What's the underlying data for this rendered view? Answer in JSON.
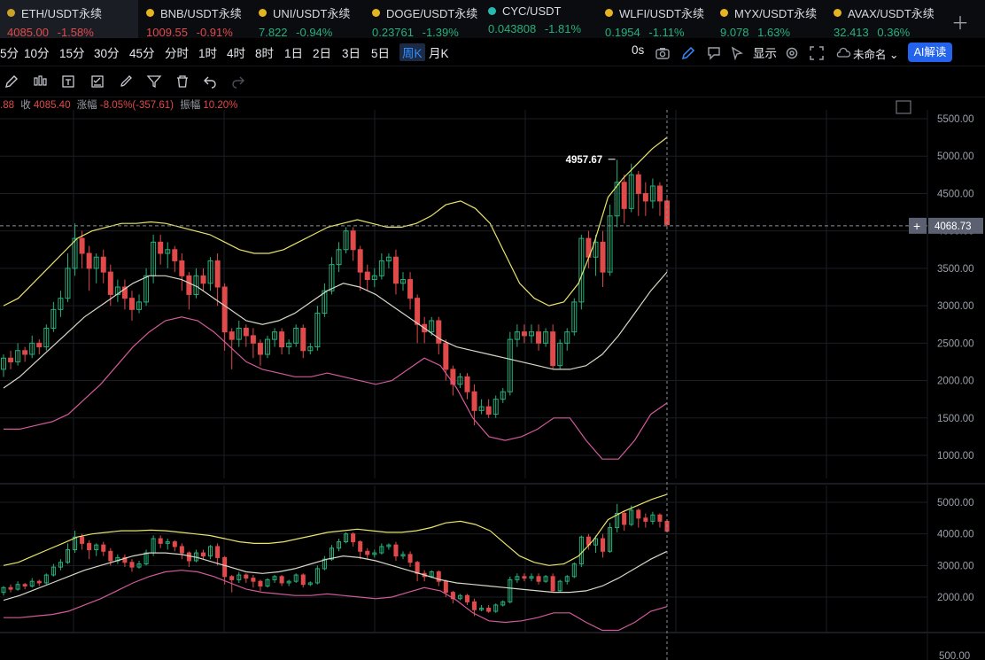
{
  "tabs": [
    {
      "name": "ETH/USDT永续",
      "price": "4085.00",
      "change": "-1.58%",
      "dir": "dn",
      "active": true,
      "dotColor": "#c9a227"
    },
    {
      "name": "BNB/USDT永续",
      "price": "1009.55",
      "change": "-0.91%",
      "dir": "dn",
      "dotColor": "#e6b422"
    },
    {
      "name": "UNI/USDT永续",
      "price": "7.822",
      "change": "-0.94%",
      "dir": "up",
      "dotColor": "#e6b422"
    },
    {
      "name": "DOGE/USDT永续",
      "price": "0.23761",
      "change": "-1.39%",
      "dir": "up",
      "dotColor": "#e6b422"
    },
    {
      "name": "CYC/USDT",
      "price": "0.043808",
      "change": "-1.81%",
      "dir": "up",
      "dotColor": "#27b8b0"
    },
    {
      "name": "WLFI/USDT永续",
      "price": "0.1954",
      "change": "-1.11%",
      "dir": "up",
      "dotColor": "#e6b422"
    },
    {
      "name": "MYX/USDT永续",
      "price": "9.078",
      "change": "1.63%",
      "dir": "up",
      "dotColor": "#e6b422"
    },
    {
      "name": "AVAX/USDT永续",
      "price": "32.413",
      "change": "0.36%",
      "dir": "up",
      "dotColor": "#e6b422"
    }
  ],
  "timeframes": [
    "5分",
    "10分",
    "15分",
    "30分",
    "45分",
    "分时",
    "1时",
    "4时",
    "8时",
    "1日",
    "2日",
    "3日",
    "5日",
    "周K",
    "月K"
  ],
  "activeTimeframe": "周K",
  "toolbarRight": {
    "countdown": "0s",
    "display": "显示",
    "layout": "未命名",
    "ai": "AI解读"
  },
  "icons": [
    "pencil-icon",
    "candles-icon",
    "text-tool-icon",
    "checklist-icon",
    "brush-icon",
    "filter-icon",
    "trash-icon",
    "undo-icon",
    "redo-icon",
    "camera-icon",
    "edit-icon",
    "alert-icon",
    "settings-icon",
    "fullscreen-icon",
    "cloud-icon"
  ],
  "info": {
    "prefix": ".88",
    "close_label": "收",
    "close": "4085.40",
    "chg_label": "涨幅",
    "chg": "-8.05%(-357.61)",
    "amp_label": "振幅",
    "amp": "10.20%"
  },
  "colors": {
    "up": "#26b07a",
    "down": "#e04a4a",
    "upper_band": "#e9e46a",
    "middle_band": "#d8d8c8",
    "lower_band": "#d25a9a",
    "crosshair_label_bg": "#5b6170"
  },
  "chart_data": {
    "type": "candlestick",
    "main": {
      "yticks": [
        5500,
        5000,
        4500,
        4000,
        3500,
        3000,
        2500,
        2000,
        1500,
        1000
      ],
      "ylim": [
        750,
        5650
      ],
      "high_label": "4957.67",
      "crosshair_value": "4068.73",
      "candles": [
        [
          2150,
          2300,
          2050,
          2350
        ],
        [
          2300,
          2250,
          2150,
          2400
        ],
        [
          2250,
          2400,
          2200,
          2500
        ],
        [
          2400,
          2350,
          2250,
          2450
        ],
        [
          2350,
          2500,
          2300,
          2600
        ],
        [
          2500,
          2450,
          2350,
          2550
        ],
        [
          2450,
          2700,
          2400,
          2750
        ],
        [
          2700,
          2950,
          2650,
          3050
        ],
        [
          2950,
          3100,
          2850,
          3200
        ],
        [
          3100,
          3500,
          3050,
          3700
        ],
        [
          3500,
          3900,
          3400,
          4100
        ],
        [
          3900,
          3700,
          3500,
          4000
        ],
        [
          3700,
          3500,
          3200,
          3800
        ],
        [
          3500,
          3650,
          3300,
          3700
        ],
        [
          3650,
          3450,
          3300,
          3750
        ],
        [
          3450,
          3150,
          3000,
          3550
        ],
        [
          3150,
          3250,
          3050,
          3350
        ],
        [
          3250,
          3100,
          2950,
          3350
        ],
        [
          3100,
          2950,
          2800,
          3200
        ],
        [
          2950,
          3050,
          2900,
          3150
        ],
        [
          3050,
          3400,
          3000,
          3500
        ],
        [
          3400,
          3850,
          3300,
          3950
        ],
        [
          3850,
          3700,
          3550,
          3950
        ],
        [
          3700,
          3750,
          3500,
          3850
        ],
        [
          3750,
          3600,
          3450,
          3800
        ],
        [
          3600,
          3400,
          3200,
          3700
        ],
        [
          3400,
          3150,
          2950,
          3450
        ],
        [
          3150,
          3400,
          3100,
          3500
        ],
        [
          3400,
          3300,
          3200,
          3500
        ],
        [
          3300,
          3600,
          3200,
          3650
        ],
        [
          3600,
          3250,
          3000,
          3700
        ],
        [
          3250,
          2650,
          2400,
          3300
        ],
        [
          2650,
          2550,
          2150,
          2700
        ],
        [
          2550,
          2700,
          2450,
          2800
        ],
        [
          2700,
          2600,
          2450,
          2750
        ],
        [
          2600,
          2500,
          2300,
          2700
        ],
        [
          2500,
          2350,
          2200,
          2550
        ],
        [
          2350,
          2550,
          2300,
          2600
        ],
        [
          2550,
          2650,
          2450,
          2700
        ],
        [
          2650,
          2450,
          2350,
          2700
        ],
        [
          2450,
          2500,
          2350,
          2550
        ],
        [
          2500,
          2700,
          2450,
          2750
        ],
        [
          2700,
          2400,
          2300,
          2750
        ],
        [
          2400,
          2450,
          2350,
          2500
        ],
        [
          2450,
          2900,
          2400,
          3000
        ],
        [
          2900,
          3200,
          2850,
          3300
        ],
        [
          3200,
          3550,
          3150,
          3650
        ],
        [
          3550,
          3750,
          3450,
          3850
        ],
        [
          3750,
          4000,
          3700,
          4050
        ],
        [
          4000,
          3750,
          3600,
          4050
        ],
        [
          3750,
          3450,
          3200,
          3800
        ],
        [
          3450,
          3350,
          3200,
          3550
        ],
        [
          3350,
          3400,
          3250,
          3500
        ],
        [
          3400,
          3600,
          3350,
          3700
        ],
        [
          3600,
          3650,
          3500,
          3700
        ],
        [
          3650,
          3300,
          3150,
          3750
        ],
        [
          3300,
          3350,
          3200,
          3450
        ],
        [
          3350,
          3100,
          2950,
          3450
        ],
        [
          3100,
          2750,
          2500,
          3150
        ],
        [
          2750,
          2650,
          2500,
          2850
        ],
        [
          2650,
          2800,
          2600,
          2850
        ],
        [
          2800,
          2500,
          2350,
          2850
        ],
        [
          2500,
          2150,
          2000,
          2550
        ],
        [
          2150,
          1950,
          1800,
          2200
        ],
        [
          1950,
          2050,
          1900,
          2100
        ],
        [
          2050,
          1850,
          1750,
          2100
        ],
        [
          1850,
          1600,
          1400,
          1950
        ],
        [
          1600,
          1650,
          1550,
          1750
        ],
        [
          1650,
          1550,
          1500,
          1750
        ],
        [
          1550,
          1750,
          1500,
          1800
        ],
        [
          1750,
          1850,
          1700,
          1900
        ],
        [
          1850,
          2550,
          1800,
          2650
        ],
        [
          2550,
          2650,
          2450,
          2750
        ],
        [
          2650,
          2600,
          2500,
          2750
        ],
        [
          2600,
          2650,
          2500,
          2750
        ],
        [
          2650,
          2500,
          2400,
          2750
        ],
        [
          2500,
          2650,
          2450,
          2700
        ],
        [
          2650,
          2200,
          2150,
          2750
        ],
        [
          2200,
          2500,
          2150,
          2550
        ],
        [
          2500,
          2650,
          2400,
          2700
        ],
        [
          2650,
          3050,
          2600,
          3100
        ],
        [
          3050,
          3900,
          2950,
          3950
        ],
        [
          3900,
          3650,
          3500,
          4000
        ],
        [
          3650,
          3850,
          3400,
          3950
        ],
        [
          3850,
          3450,
          3250,
          4000
        ],
        [
          3450,
          4200,
          3400,
          4350
        ],
        [
          4200,
          4650,
          4050,
          4950
        ],
        [
          4650,
          4300,
          4100,
          4750
        ],
        [
          4300,
          4750,
          4250,
          4900
        ],
        [
          4750,
          4500,
          4200,
          4800
        ],
        [
          4500,
          4400,
          4200,
          4650
        ],
        [
          4400,
          4600,
          4300,
          4700
        ],
        [
          4600,
          4400,
          4200,
          4650
        ],
        [
          4400,
          4085,
          4050,
          4450
        ]
      ],
      "bands": {
        "upper": [
          3000,
          3100,
          3300,
          3500,
          3700,
          3900,
          4000,
          4050,
          4100,
          4100,
          4120,
          4100,
          4050,
          4000,
          3950,
          3850,
          3750,
          3700,
          3700,
          3750,
          3850,
          3950,
          4050,
          4100,
          4150,
          4100,
          4050,
          4050,
          4100,
          4200,
          4350,
          4400,
          4300,
          4100,
          3700,
          3300,
          3100,
          3000,
          3050,
          3300,
          3800,
          4450,
          4700,
          4900,
          5100,
          5250
        ],
        "middle": [
          1900,
          2050,
          2250,
          2450,
          2650,
          2850,
          3000,
          3150,
          3300,
          3400,
          3400,
          3350,
          3250,
          3100,
          2950,
          2800,
          2750,
          2800,
          2900,
          3050,
          3200,
          3300,
          3250,
          3150,
          3000,
          2850,
          2700,
          2550,
          2450,
          2400,
          2350,
          2300,
          2250,
          2200,
          2150,
          2150,
          2200,
          2350,
          2600,
          2900,
          3200,
          3450
        ],
        "lower": [
          1350,
          1350,
          1400,
          1450,
          1550,
          1750,
          1950,
          2200,
          2450,
          2650,
          2800,
          2850,
          2800,
          2650,
          2450,
          2250,
          2150,
          2100,
          2050,
          2050,
          2100,
          2050,
          2000,
          1950,
          2000,
          2150,
          2300,
          2200,
          1900,
          1500,
          1250,
          1200,
          1250,
          1350,
          1500,
          1500,
          1200,
          950,
          950,
          1200,
          1550,
          1700
        ]
      }
    },
    "sub": {
      "yticks": [
        5000,
        4000,
        3000,
        2000
      ],
      "ylim": [
        1100,
        5500
      ],
      "bottom_tick": "500.00"
    }
  }
}
